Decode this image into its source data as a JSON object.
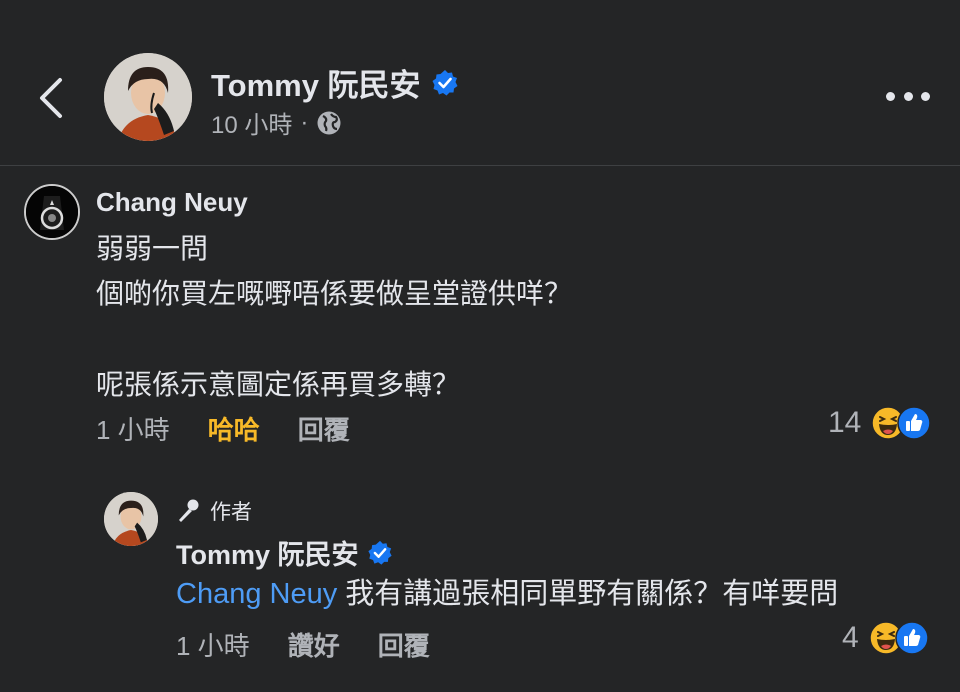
{
  "header": {
    "author_name": "Tommy 阮民安",
    "time": "10 小時",
    "separator": "·",
    "privacy_icon": "globe-icon",
    "more_icon": "more-dots-icon",
    "back_icon": "chevron-left-icon"
  },
  "comment": {
    "author": "Chang Neuy",
    "lines": [
      "弱弱一問",
      "個啲你買左嘅嘢唔係要做呈堂證供咩？",
      "",
      "呢張係示意圖定係再買多轉？"
    ],
    "time": "1 小時",
    "reaction_label": "哈哈",
    "reply_label": "回覆",
    "reaction_count": "14",
    "reaction_icons": [
      "haha-emoji-icon",
      "like-icon"
    ]
  },
  "reply": {
    "badge": "作者",
    "badge_icon": "microphone-icon",
    "author": "Tommy 阮民安",
    "mention": "Chang Neuy",
    "text": " 我有講過張相同單野有關係？有咩要問",
    "time": "1 小時",
    "like_label": "讚好",
    "reply_label": "回覆",
    "reaction_count": "4",
    "reaction_icons": [
      "haha-emoji-icon",
      "like-icon"
    ]
  },
  "colors": {
    "background": "#242526",
    "text": "#e4e6eb",
    "secondary": "#b0b3b8",
    "mention": "#4e9cf5",
    "haha": "#f7b928",
    "verified": "#1877f2"
  }
}
